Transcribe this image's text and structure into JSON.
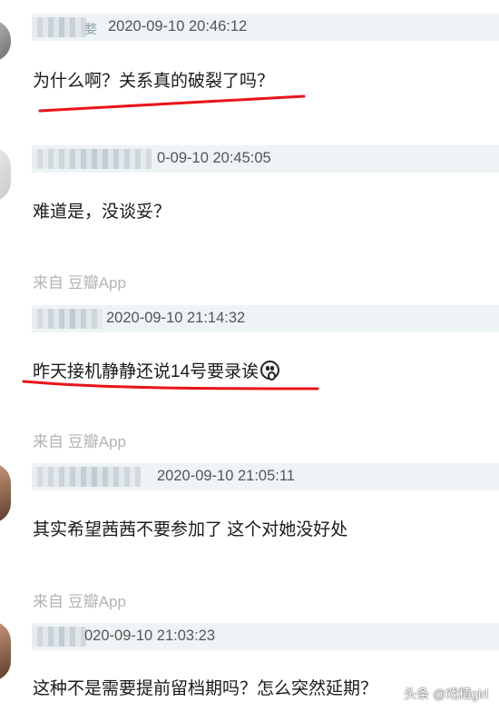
{
  "posts": [
    {
      "timestamp": "2020-09-10 20:46:12",
      "username_partial": "婺",
      "content": "为什么啊？关系真的破裂了吗？",
      "underline_color": "#e8141a"
    },
    {
      "timestamp": "0-09-10 20:45:05",
      "content": "难道是，没谈妥？",
      "source": "来自 豆瓣App"
    },
    {
      "timestamp": "2020-09-10 21:14:32",
      "content": "昨天接机静静还说14号要录诶",
      "emoji": "scream-emoji",
      "source": "来自 豆瓣App",
      "underline_color": "#e8141a"
    },
    {
      "timestamp": "2020-09-10 21:05:11",
      "content": "其实希望茜茜不要参加了 这个对她没好处",
      "source": "来自 豆瓣App"
    },
    {
      "timestamp": "020-09-10 21:03:23",
      "content": "这种不是需要提前留档期吗？怎么突然延期？"
    }
  ],
  "watermark": "头条 @戏精girl",
  "colors": {
    "meta_background": "#eef3f5",
    "timestamp": "#555555",
    "source": "#b4b4b4",
    "underline": "#e8141a"
  }
}
